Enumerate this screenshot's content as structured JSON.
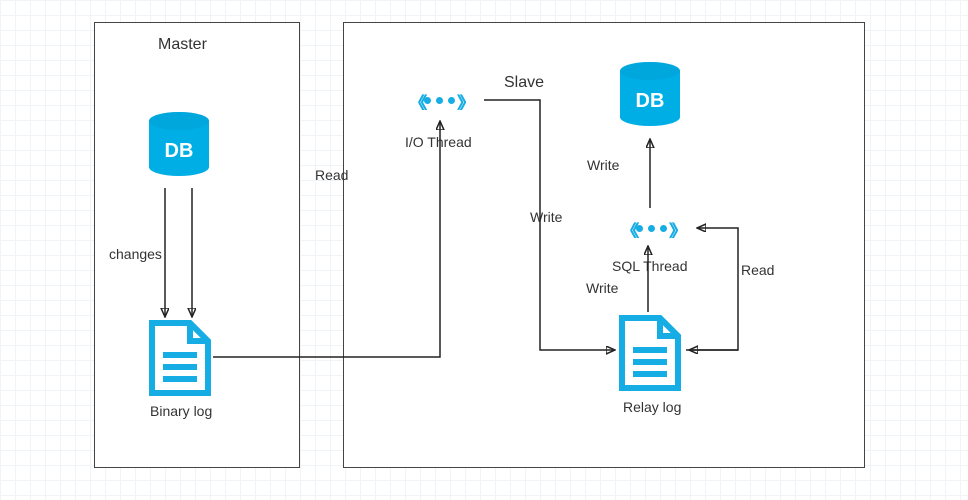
{
  "master": {
    "title": "Master",
    "db_label": "DB",
    "log_label": "Binary log",
    "changes_label": "changes"
  },
  "slave": {
    "title": "Slave",
    "db_label": "DB",
    "log_label": "Relay log",
    "io_thread_label": "I/O Thread",
    "sql_thread_label": "SQL Thread",
    "write_to_relay": "Write",
    "write_from_relay": "Write",
    "write_to_db": "Write",
    "read_relay": "Read"
  },
  "link": {
    "read_label": "Read"
  }
}
